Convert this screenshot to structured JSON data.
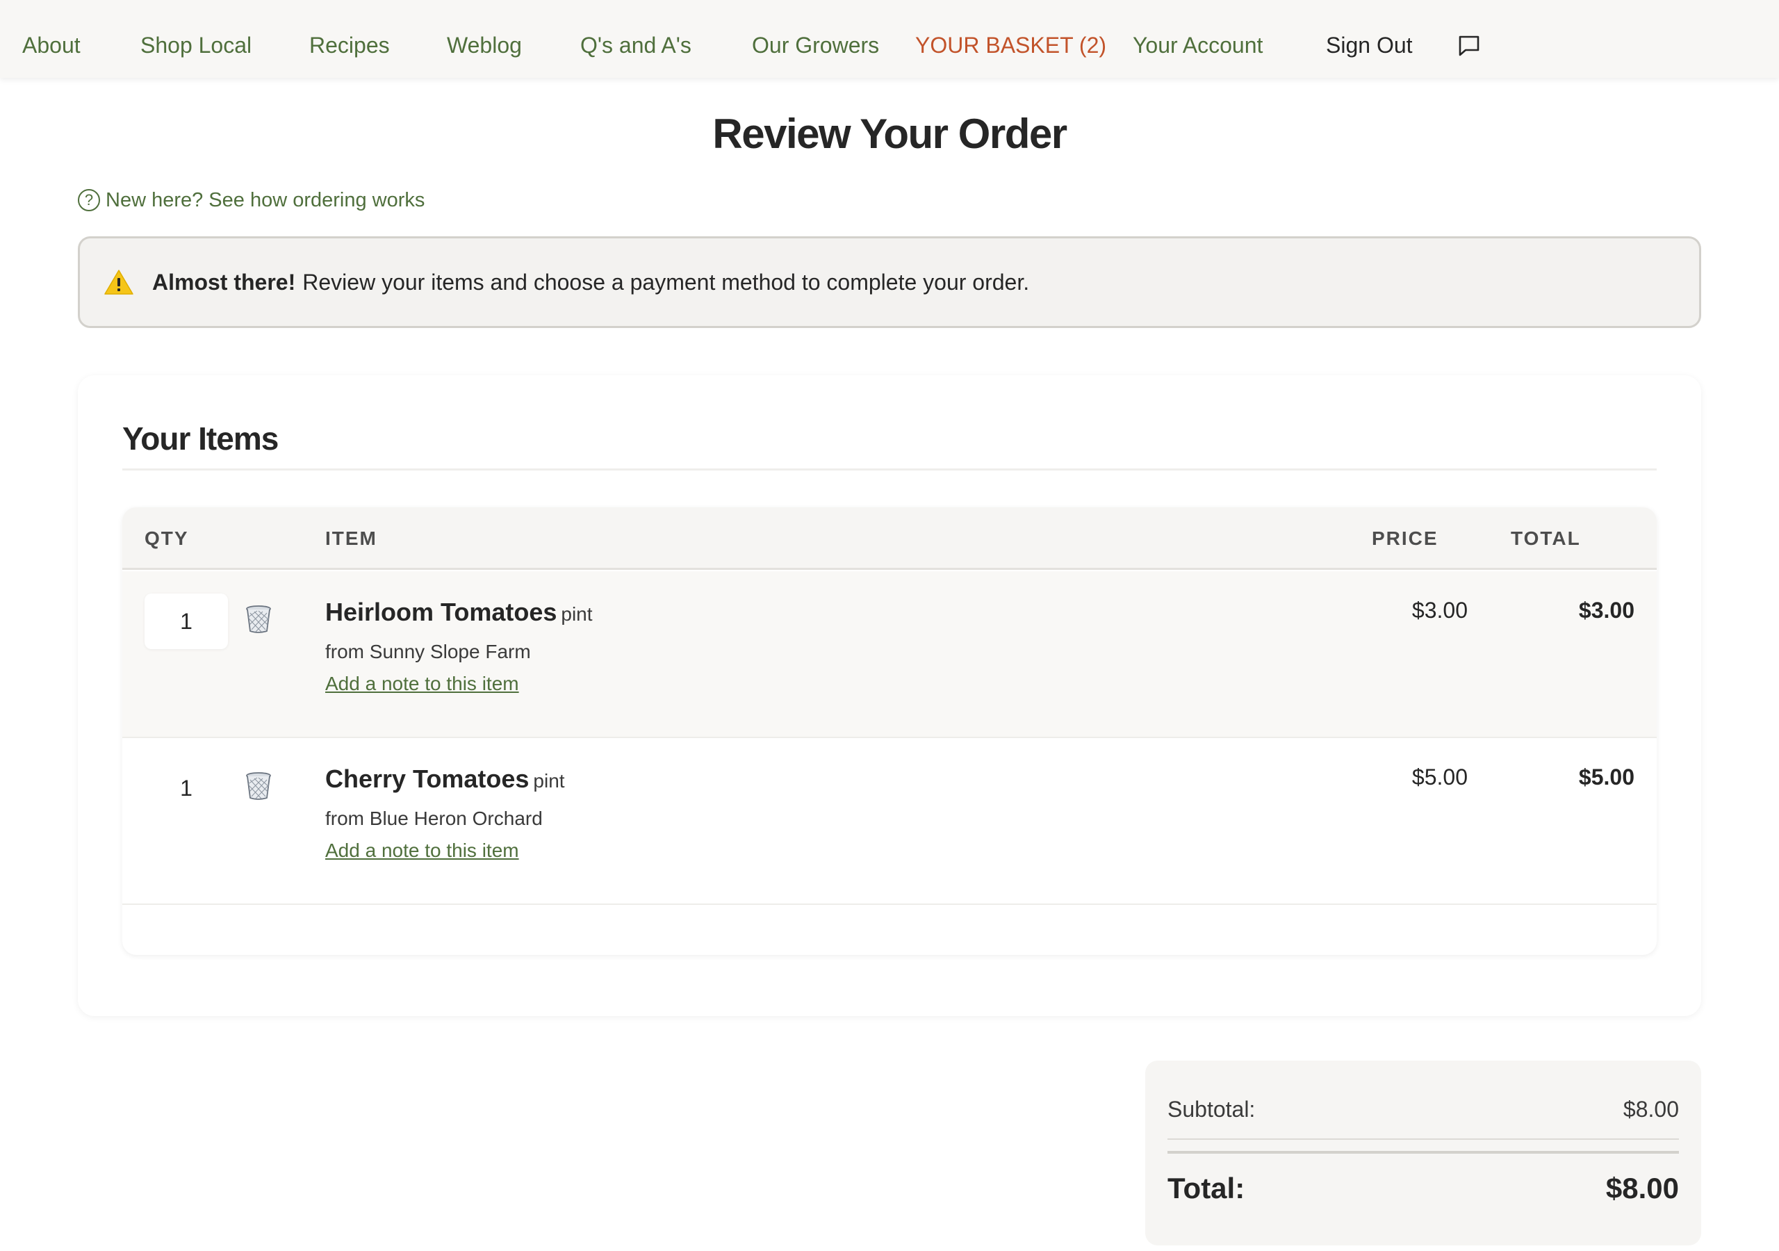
{
  "nav": {
    "about": "About",
    "shop_local": "Shop Local",
    "recipes": "Recipes",
    "weblog": "Weblog",
    "qa": "Q's and A's",
    "growers": "Our Growers",
    "basket": "YOUR BASKET (2)",
    "account": "Your Account",
    "signout": "Sign Out",
    "chat_icon": "chat-bubble-icon"
  },
  "page": {
    "title": "Review Your Order",
    "help_link": "New here? See how ordering works",
    "help_icon": "question-circle-icon"
  },
  "alert": {
    "icon": "warning-icon",
    "strong": "Almost there!",
    "message": "Review your items and choose a payment method to complete your order."
  },
  "items": {
    "heading": "Your Items",
    "columns": {
      "qty": "QTY",
      "item": "ITEM",
      "price": "PRICE",
      "total": "TOTAL"
    },
    "rows": [
      {
        "qty": "1",
        "name": "Heirloom Tomatoes",
        "unit": "pint",
        "farm": "from Sunny Slope Farm",
        "note_link": "Add a note to this item",
        "price": "$3.00",
        "total": "$3.00"
      },
      {
        "qty": "1",
        "name": "Cherry Tomatoes",
        "unit": "pint",
        "farm": "from Blue Heron Orchard",
        "note_link": "Add a note to this item",
        "price": "$5.00",
        "total": "$5.00"
      }
    ]
  },
  "summary": {
    "subtotal_label": "Subtotal:",
    "subtotal_value": "$8.00",
    "total_label": "Total:",
    "total_value": "$8.00"
  },
  "colors": {
    "nav_green": "#4f6f3c",
    "basket_accent": "#c2532a",
    "warning_yellow": "#f5c518"
  }
}
